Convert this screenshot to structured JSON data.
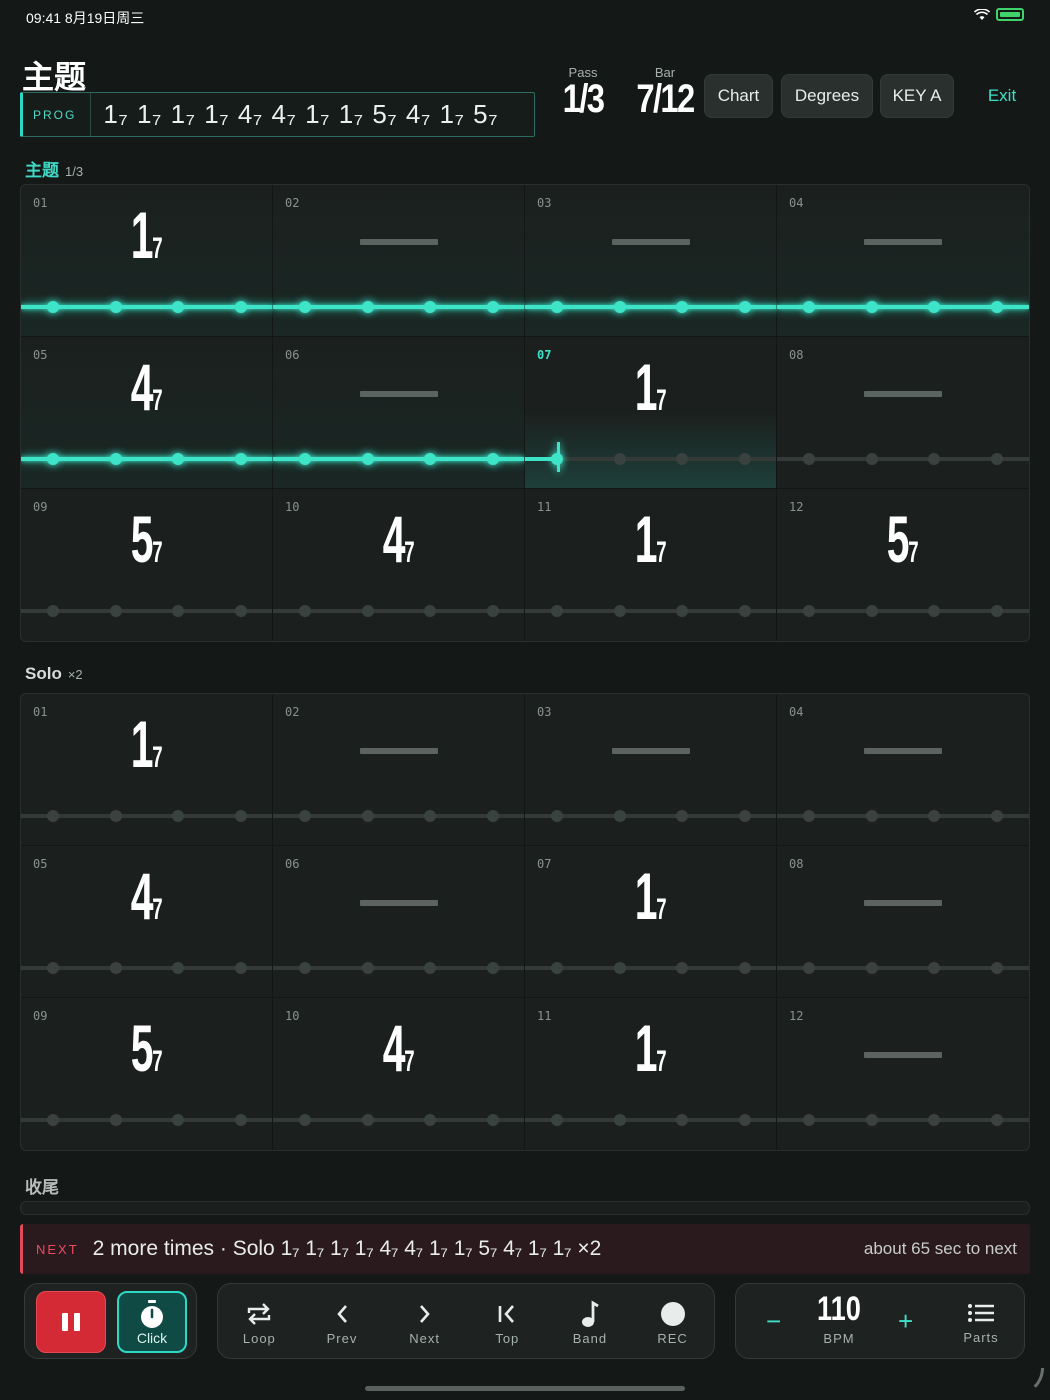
{
  "status": {
    "time_date": "09:41  8月19日周三"
  },
  "header": {
    "title": "主题",
    "prog_tag": "PROG",
    "prog_sequence": "1₇ 1₇ 1₇ 1₇  4₇ 4₇ 1₇ 1₇  5₇ 4₇ 1₇ 5₇",
    "pass_label": "Pass",
    "pass_value": "1/3",
    "bar_label": "Bar",
    "bar_value": "7/12",
    "buttons": {
      "chart": "Chart",
      "degrees": "Degrees",
      "key": "KEY A",
      "exit": "Exit"
    }
  },
  "sections": [
    {
      "name": "主题",
      "sub": "1/3",
      "bars": [
        {
          "n": "01",
          "root": "1",
          "q": "7"
        },
        {
          "n": "02",
          "root": "",
          "q": ""
        },
        {
          "n": "03",
          "root": "",
          "q": ""
        },
        {
          "n": "04",
          "root": "",
          "q": ""
        },
        {
          "n": "05",
          "root": "4",
          "q": "7"
        },
        {
          "n": "06",
          "root": "",
          "q": ""
        },
        {
          "n": "07",
          "root": "1",
          "q": "7"
        },
        {
          "n": "08",
          "root": "",
          "q": ""
        },
        {
          "n": "09",
          "root": "5",
          "q": "7"
        },
        {
          "n": "10",
          "root": "4",
          "q": "7"
        },
        {
          "n": "11",
          "root": "1",
          "q": "7"
        },
        {
          "n": "12",
          "root": "5",
          "q": "7"
        }
      ]
    },
    {
      "name": "Solo",
      "sub": "×2",
      "bars": [
        {
          "n": "01",
          "root": "1",
          "q": "7"
        },
        {
          "n": "02",
          "root": "",
          "q": ""
        },
        {
          "n": "03",
          "root": "",
          "q": ""
        },
        {
          "n": "04",
          "root": "",
          "q": ""
        },
        {
          "n": "05",
          "root": "4",
          "q": "7"
        },
        {
          "n": "06",
          "root": "",
          "q": ""
        },
        {
          "n": "07",
          "root": "1",
          "q": "7"
        },
        {
          "n": "08",
          "root": "",
          "q": ""
        },
        {
          "n": "09",
          "root": "5",
          "q": "7"
        },
        {
          "n": "10",
          "root": "4",
          "q": "7"
        },
        {
          "n": "11",
          "root": "1",
          "q": "7"
        },
        {
          "n": "12",
          "root": "",
          "q": ""
        }
      ]
    },
    {
      "name": "收尾",
      "sub": ""
    }
  ],
  "playback": {
    "current_section": 0,
    "current_bar": 7,
    "played_bars": 6
  },
  "next": {
    "tag": "NEXT",
    "text": "2 more times · Solo 1₇ 1₇ 1₇ 1₇ 4₇ 4₇ 1₇ 1₇ 5₇ 4₇ 1₇ 1₇ ×2",
    "eta": "about 65 sec to next"
  },
  "transport": {
    "click": "Click",
    "loop": "Loop",
    "prev": "Prev",
    "next": "Next",
    "top": "Top",
    "band": "Band",
    "rec": "REC",
    "bpm_value": "110",
    "bpm_label": "BPM",
    "minus": "−",
    "plus": "+",
    "parts": "Parts"
  },
  "colors": {
    "accent": "#3ee4c8",
    "alert": "#e24a5c",
    "background": "#141816"
  }
}
